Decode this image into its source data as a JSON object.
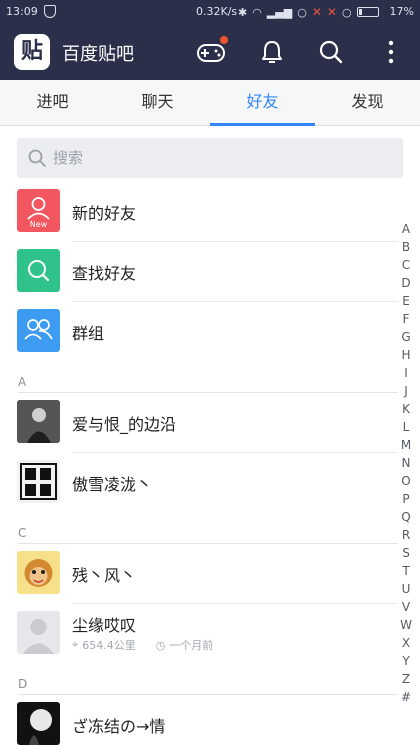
{
  "status_bar": {
    "time": "13:09",
    "speed": "0.32K/s",
    "battery": "17%"
  },
  "app_bar": {
    "logo_char": "贴",
    "title": "百度贴吧"
  },
  "tabs": [
    {
      "label": "进吧",
      "active": false
    },
    {
      "label": "聊天",
      "active": false
    },
    {
      "label": "好友",
      "active": true
    },
    {
      "label": "发现",
      "active": false
    }
  ],
  "search": {
    "placeholder": "搜索"
  },
  "quick_items": [
    {
      "label": "新的好友",
      "color": "#f25760",
      "icon": "new-friend-icon",
      "badge": "New"
    },
    {
      "label": "查找好友",
      "color": "#2fc28a",
      "icon": "search-icon"
    },
    {
      "label": "群组",
      "color": "#3d9cf1",
      "icon": "group-icon"
    }
  ],
  "sections": [
    {
      "letter": "A",
      "contacts": [
        {
          "name": "爱与恨_的边沿"
        },
        {
          "name": "傲雪凌泷丶"
        }
      ]
    },
    {
      "letter": "C",
      "contacts": [
        {
          "name": "残丶风丶"
        },
        {
          "name": "尘缘哎叹",
          "distance": "654.4公里",
          "time": "一个月前"
        }
      ]
    },
    {
      "letter": "D",
      "contacts": [
        {
          "name": "ざ冻结の→情"
        }
      ]
    }
  ],
  "index_letters": [
    "A",
    "B",
    "C",
    "D",
    "E",
    "F",
    "G",
    "H",
    "I",
    "J",
    "K",
    "L",
    "M",
    "N",
    "O",
    "P",
    "Q",
    "R",
    "S",
    "T",
    "U",
    "V",
    "W",
    "X",
    "Y",
    "Z",
    "#"
  ],
  "colors": {
    "header_bg": "#2b2f4a",
    "accent": "#3385ff"
  }
}
